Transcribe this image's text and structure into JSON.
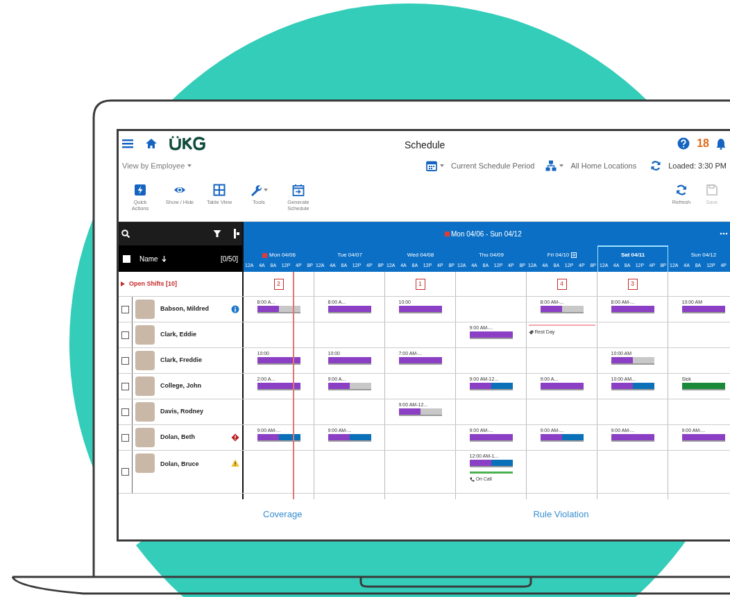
{
  "header": {
    "title": "Schedule",
    "notification_count": "18"
  },
  "filters": {
    "view": "View by Employee",
    "period": "Current Schedule Period",
    "locations": "All Home Locations",
    "loaded": "Loaded: 3:30 PM"
  },
  "toolbar": [
    {
      "label": "Quick Actions",
      "kind": "bolt"
    },
    {
      "label": "Show / Hide",
      "kind": "eye"
    },
    {
      "label": "Table View",
      "kind": "table"
    },
    {
      "label": "Tools",
      "kind": "wrench"
    },
    {
      "label": "Generate Schedule",
      "kind": "calendar"
    }
  ],
  "toolbar_right": [
    {
      "label": "Refresh",
      "kind": "refresh",
      "disabled": false
    },
    {
      "label": "Save",
      "kind": "save",
      "disabled": true
    }
  ],
  "grid": {
    "range": "Mon 04/06 - Sun 04/12",
    "name_header": "Name",
    "all_checked": false,
    "count": "[0/50]",
    "days": [
      {
        "label": "Mon 04/06",
        "today": true,
        "note": false,
        "selected": false,
        "hours": [
          "12A",
          "4A",
          "8A",
          "12P",
          "4P",
          "8P"
        ]
      },
      {
        "label": "Tue 04/07",
        "today": false,
        "note": false,
        "selected": false,
        "hours": [
          "12A",
          "4A",
          "8A",
          "12P",
          "4P",
          "8P"
        ]
      },
      {
        "label": "Wed 04/08",
        "today": false,
        "note": false,
        "selected": false,
        "hours": [
          "12A",
          "4A",
          "8A",
          "12P",
          "4P",
          "8P"
        ]
      },
      {
        "label": "Thu 04/09",
        "today": false,
        "note": false,
        "selected": false,
        "hours": [
          "12A",
          "4A",
          "8A",
          "12P",
          "4P",
          "8P"
        ]
      },
      {
        "label": "Fri 04/10",
        "today": false,
        "note": true,
        "selected": false,
        "hours": [
          "12A",
          "4A",
          "8A",
          "12P",
          "4P",
          "8P"
        ]
      },
      {
        "label": "Sat 04/11",
        "today": false,
        "note": false,
        "selected": true,
        "hours": [
          "12A",
          "4A",
          "8A",
          "12P",
          "4P",
          "8P"
        ]
      },
      {
        "label": "Sun 04/12",
        "today": false,
        "note": false,
        "selected": false,
        "hours": [
          "12A",
          "4A",
          "8A",
          "12P",
          "4P"
        ]
      }
    ],
    "open_shifts": {
      "label": "Open Shifts [10]",
      "expanded": false,
      "counts": [
        {
          "kind": "count",
          "text": "2"
        },
        {
          "kind": "empty"
        },
        {
          "kind": "count",
          "text": "1"
        },
        {
          "kind": "empty"
        },
        {
          "kind": "count",
          "text": "4"
        },
        {
          "kind": "count",
          "text": "3"
        },
        {
          "kind": "empty"
        }
      ]
    },
    "employees": [
      {
        "name": "Babson, Mildred",
        "checked": false,
        "alert": {
          "kind": "info"
        },
        "days": [
          {
            "kind": "shift",
            "time": "8:00 A...",
            "segments": [
              {
                "color": "#8a3fc4"
              },
              {
                "color": "#c8c8c8"
              }
            ]
          },
          {
            "kind": "shift",
            "time": "8:00 A...",
            "segments": [
              {
                "color": "#8a3fc4"
              }
            ]
          },
          {
            "kind": "shift",
            "time": "10:00",
            "segments": [
              {
                "color": "#8a3fc4"
              }
            ]
          },
          {
            "kind": "empty"
          },
          {
            "kind": "shift",
            "time": "8:00 AM-...",
            "segments": [
              {
                "color": "#8a3fc4"
              },
              {
                "color": "#c8c8c8"
              }
            ]
          },
          {
            "kind": "shift",
            "time": "8:00 AM-...",
            "segments": [
              {
                "color": "#8a3fc4"
              }
            ]
          },
          {
            "kind": "shift",
            "time": "10:00 AM",
            "segments": [
              {
                "color": "#8a3fc4"
              }
            ]
          }
        ]
      },
      {
        "name": "Clark, Eddie",
        "checked": false,
        "days": [
          {
            "kind": "empty"
          },
          {
            "kind": "empty"
          },
          {
            "kind": "empty"
          },
          {
            "kind": "shift",
            "time": "9:00 AM-...",
            "segments": [
              {
                "color": "#8a3fc4"
              }
            ]
          },
          {
            "kind": "rest",
            "time": "Rest Day"
          },
          {
            "kind": "empty"
          },
          {
            "kind": "empty"
          }
        ]
      },
      {
        "name": "Clark, Freddie",
        "checked": false,
        "days": [
          {
            "kind": "shift",
            "time": "10:00",
            "segments": [
              {
                "color": "#8a3fc4"
              }
            ]
          },
          {
            "kind": "shift",
            "time": "10:00",
            "segments": [
              {
                "color": "#8a3fc4"
              }
            ]
          },
          {
            "kind": "shift",
            "time": "7:00 AM-...",
            "segments": [
              {
                "color": "#8a3fc4"
              }
            ]
          },
          {
            "kind": "empty"
          },
          {
            "kind": "empty"
          },
          {
            "kind": "shift",
            "time": "10:00 AM",
            "segments": [
              {
                "color": "#8a3fc4"
              },
              {
                "color": "#c8c8c8"
              }
            ]
          },
          {
            "kind": "empty"
          }
        ]
      },
      {
        "name": "College, John",
        "checked": false,
        "days": [
          {
            "kind": "shift",
            "time": "2:00 A...",
            "segments": [
              {
                "color": "#8a3fc4"
              }
            ]
          },
          {
            "kind": "shift",
            "time": "9:00 A...",
            "segments": [
              {
                "color": "#8a3fc4"
              },
              {
                "color": "#c8c8c8"
              }
            ]
          },
          {
            "kind": "empty"
          },
          {
            "kind": "shift",
            "time": "9:00 AM-12...",
            "segments": [
              {
                "color": "#8a3fc4"
              },
              {
                "color": "#0a70b8"
              }
            ]
          },
          {
            "kind": "shift",
            "time": "9:00 A...",
            "segments": [
              {
                "color": "#8a3fc4"
              }
            ]
          },
          {
            "kind": "shift",
            "time": "10:00 AM...",
            "segments": [
              {
                "color": "#8a3fc4"
              },
              {
                "color": "#0a70b8"
              }
            ]
          },
          {
            "kind": "shift",
            "time": "Sick",
            "segments": [
              {
                "color": "#1a8a3a"
              }
            ]
          }
        ]
      },
      {
        "name": "Davis, Rodney",
        "checked": false,
        "days": [
          {
            "kind": "empty"
          },
          {
            "kind": "empty"
          },
          {
            "kind": "shift",
            "time": "9:00 AM-12...",
            "segments": [
              {
                "color": "#8a3fc4"
              },
              {
                "color": "#c8c8c8"
              }
            ]
          },
          {
            "kind": "empty"
          },
          {
            "kind": "empty"
          },
          {
            "kind": "empty"
          },
          {
            "kind": "empty"
          }
        ]
      },
      {
        "name": "Dolan, Beth",
        "checked": false,
        "alert": {
          "kind": "error"
        },
        "days": [
          {
            "kind": "shift",
            "time": "9:00 AM-...",
            "segments": [
              {
                "color": "#8a3fc4"
              },
              {
                "color": "#0a70b8"
              }
            ]
          },
          {
            "kind": "shift",
            "time": "9:00 AM-...",
            "segments": [
              {
                "color": "#8a3fc4"
              },
              {
                "color": "#0a70b8"
              }
            ]
          },
          {
            "kind": "empty"
          },
          {
            "kind": "shift",
            "time": "9:00 AM-...",
            "segments": [
              {
                "color": "#8a3fc4"
              }
            ]
          },
          {
            "kind": "shift",
            "time": "9:00 AM-...",
            "segments": [
              {
                "color": "#8a3fc4"
              },
              {
                "color": "#0a70b8"
              }
            ]
          },
          {
            "kind": "shift",
            "time": "9:00 AM-...",
            "segments": [
              {
                "color": "#8a3fc4"
              }
            ]
          },
          {
            "kind": "shift",
            "time": "9:00 AM-...",
            "segments": [
              {
                "color": "#8a3fc4"
              }
            ]
          }
        ]
      },
      {
        "name": "Dolan, Bruce",
        "checked": false,
        "alert": {
          "kind": "warning"
        },
        "days": [
          {
            "kind": "empty"
          },
          {
            "kind": "empty"
          },
          {
            "kind": "empty"
          },
          {
            "kind": "shift",
            "time": "12:00 AM-1...",
            "segments": [
              {
                "color": "#8a3fc4"
              },
              {
                "color": "#0a70b8"
              }
            ],
            "on_call": "On Call"
          },
          {
            "kind": "empty"
          },
          {
            "kind": "empty"
          },
          {
            "kind": "empty"
          }
        ]
      }
    ]
  },
  "captions": [
    "Coverage",
    "Rule Violation"
  ]
}
